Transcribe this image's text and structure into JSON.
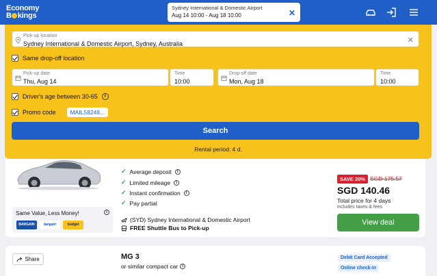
{
  "header": {
    "logo_line1": "Economy",
    "logo_line2_a": "B",
    "logo_line2_b": "kings",
    "summary_location": "Sydney International & Domestic Airport",
    "summary_dates": "Aug 14 10:00 - Aug 18 10:00",
    "icons": [
      "car-icon",
      "login-icon",
      "menu-icon"
    ]
  },
  "search": {
    "pickup_label": "Pick-up location",
    "pickup_value": "Sydney International & Domestic Airport, Sydney, Australia",
    "same_dropoff": "Same drop-off location",
    "pickup_date_label": "Pick-up date",
    "pickup_date_value": "Thu, Aug 14",
    "pickup_time_label": "Time",
    "pickup_time_value": "10:00",
    "dropoff_date_label": "Drop-off date",
    "dropoff_date_value": "Mon, Aug 18",
    "dropoff_time_label": "Time",
    "dropoff_time_value": "10:00",
    "driver_age": "Driver's age between 30-65",
    "promo_label": "Promo code",
    "promo_value": "MAIL58248...",
    "search_button": "Search",
    "rental_period": "Rental period: 4 d."
  },
  "result1": {
    "features": [
      "Average deposit",
      "Limited mileage",
      "Instant confirmation",
      "Pay partial"
    ],
    "location": "(SYD) Sydney International & Domestic Airport",
    "shuttle": "FREE Shuttle Bus to Pick-up",
    "promo_box_title": "Same Value, Less Money!",
    "promo_logos": [
      "BARGAIN",
      "bargain",
      "budget"
    ],
    "save_badge": "SAVE 20%",
    "old_price": "SGD 175.57",
    "price": "SGD 140.46",
    "total": "Total price for 4 days",
    "taxes": "includes taxes & fees",
    "cta": "View deal"
  },
  "result2": {
    "share": "Share",
    "model": "MG 3",
    "similar": "or similar compact car",
    "tags": [
      "Debit Card Accepted",
      "Online check-in"
    ]
  },
  "colors": {
    "brand_blue": "#1f5fc7",
    "brand_yellow": "#f8c21d",
    "cta_green": "#43a047",
    "sale_red": "#d9212f"
  }
}
